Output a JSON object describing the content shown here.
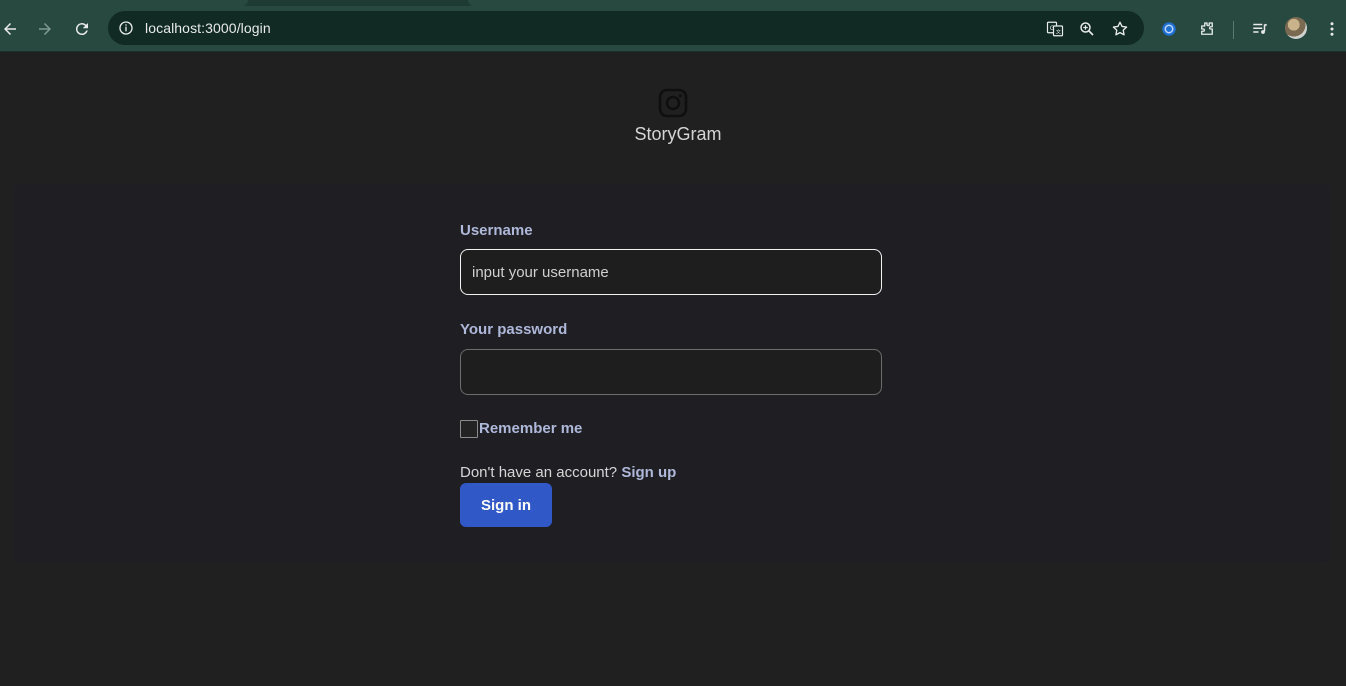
{
  "browser": {
    "url": "localhost:3000/login",
    "icons": [
      "back-icon",
      "forward-icon",
      "reload-icon",
      "site-info-icon",
      "translate-icon",
      "zoom-icon",
      "bookmark-star-icon",
      "extension-icon",
      "extensions-puzzle-icon",
      "media-control-icon",
      "profile-avatar",
      "more-menu-icon"
    ]
  },
  "brand": {
    "name": "StoryGram",
    "icon": "instagram-icon"
  },
  "form": {
    "username_label": "Username",
    "username_placeholder": "input your username",
    "password_label": "Your password",
    "remember_label": "Remember me",
    "no_account_text": "Don't have an account?",
    "signup_label": "Sign up",
    "signin_label": "Sign in"
  },
  "colors": {
    "page_bg": "#202020",
    "card_bg": "#1f1e23",
    "label": "#aeb8d9",
    "accent_button": "#3158c7",
    "browser_toolbar": "#27493f"
  }
}
